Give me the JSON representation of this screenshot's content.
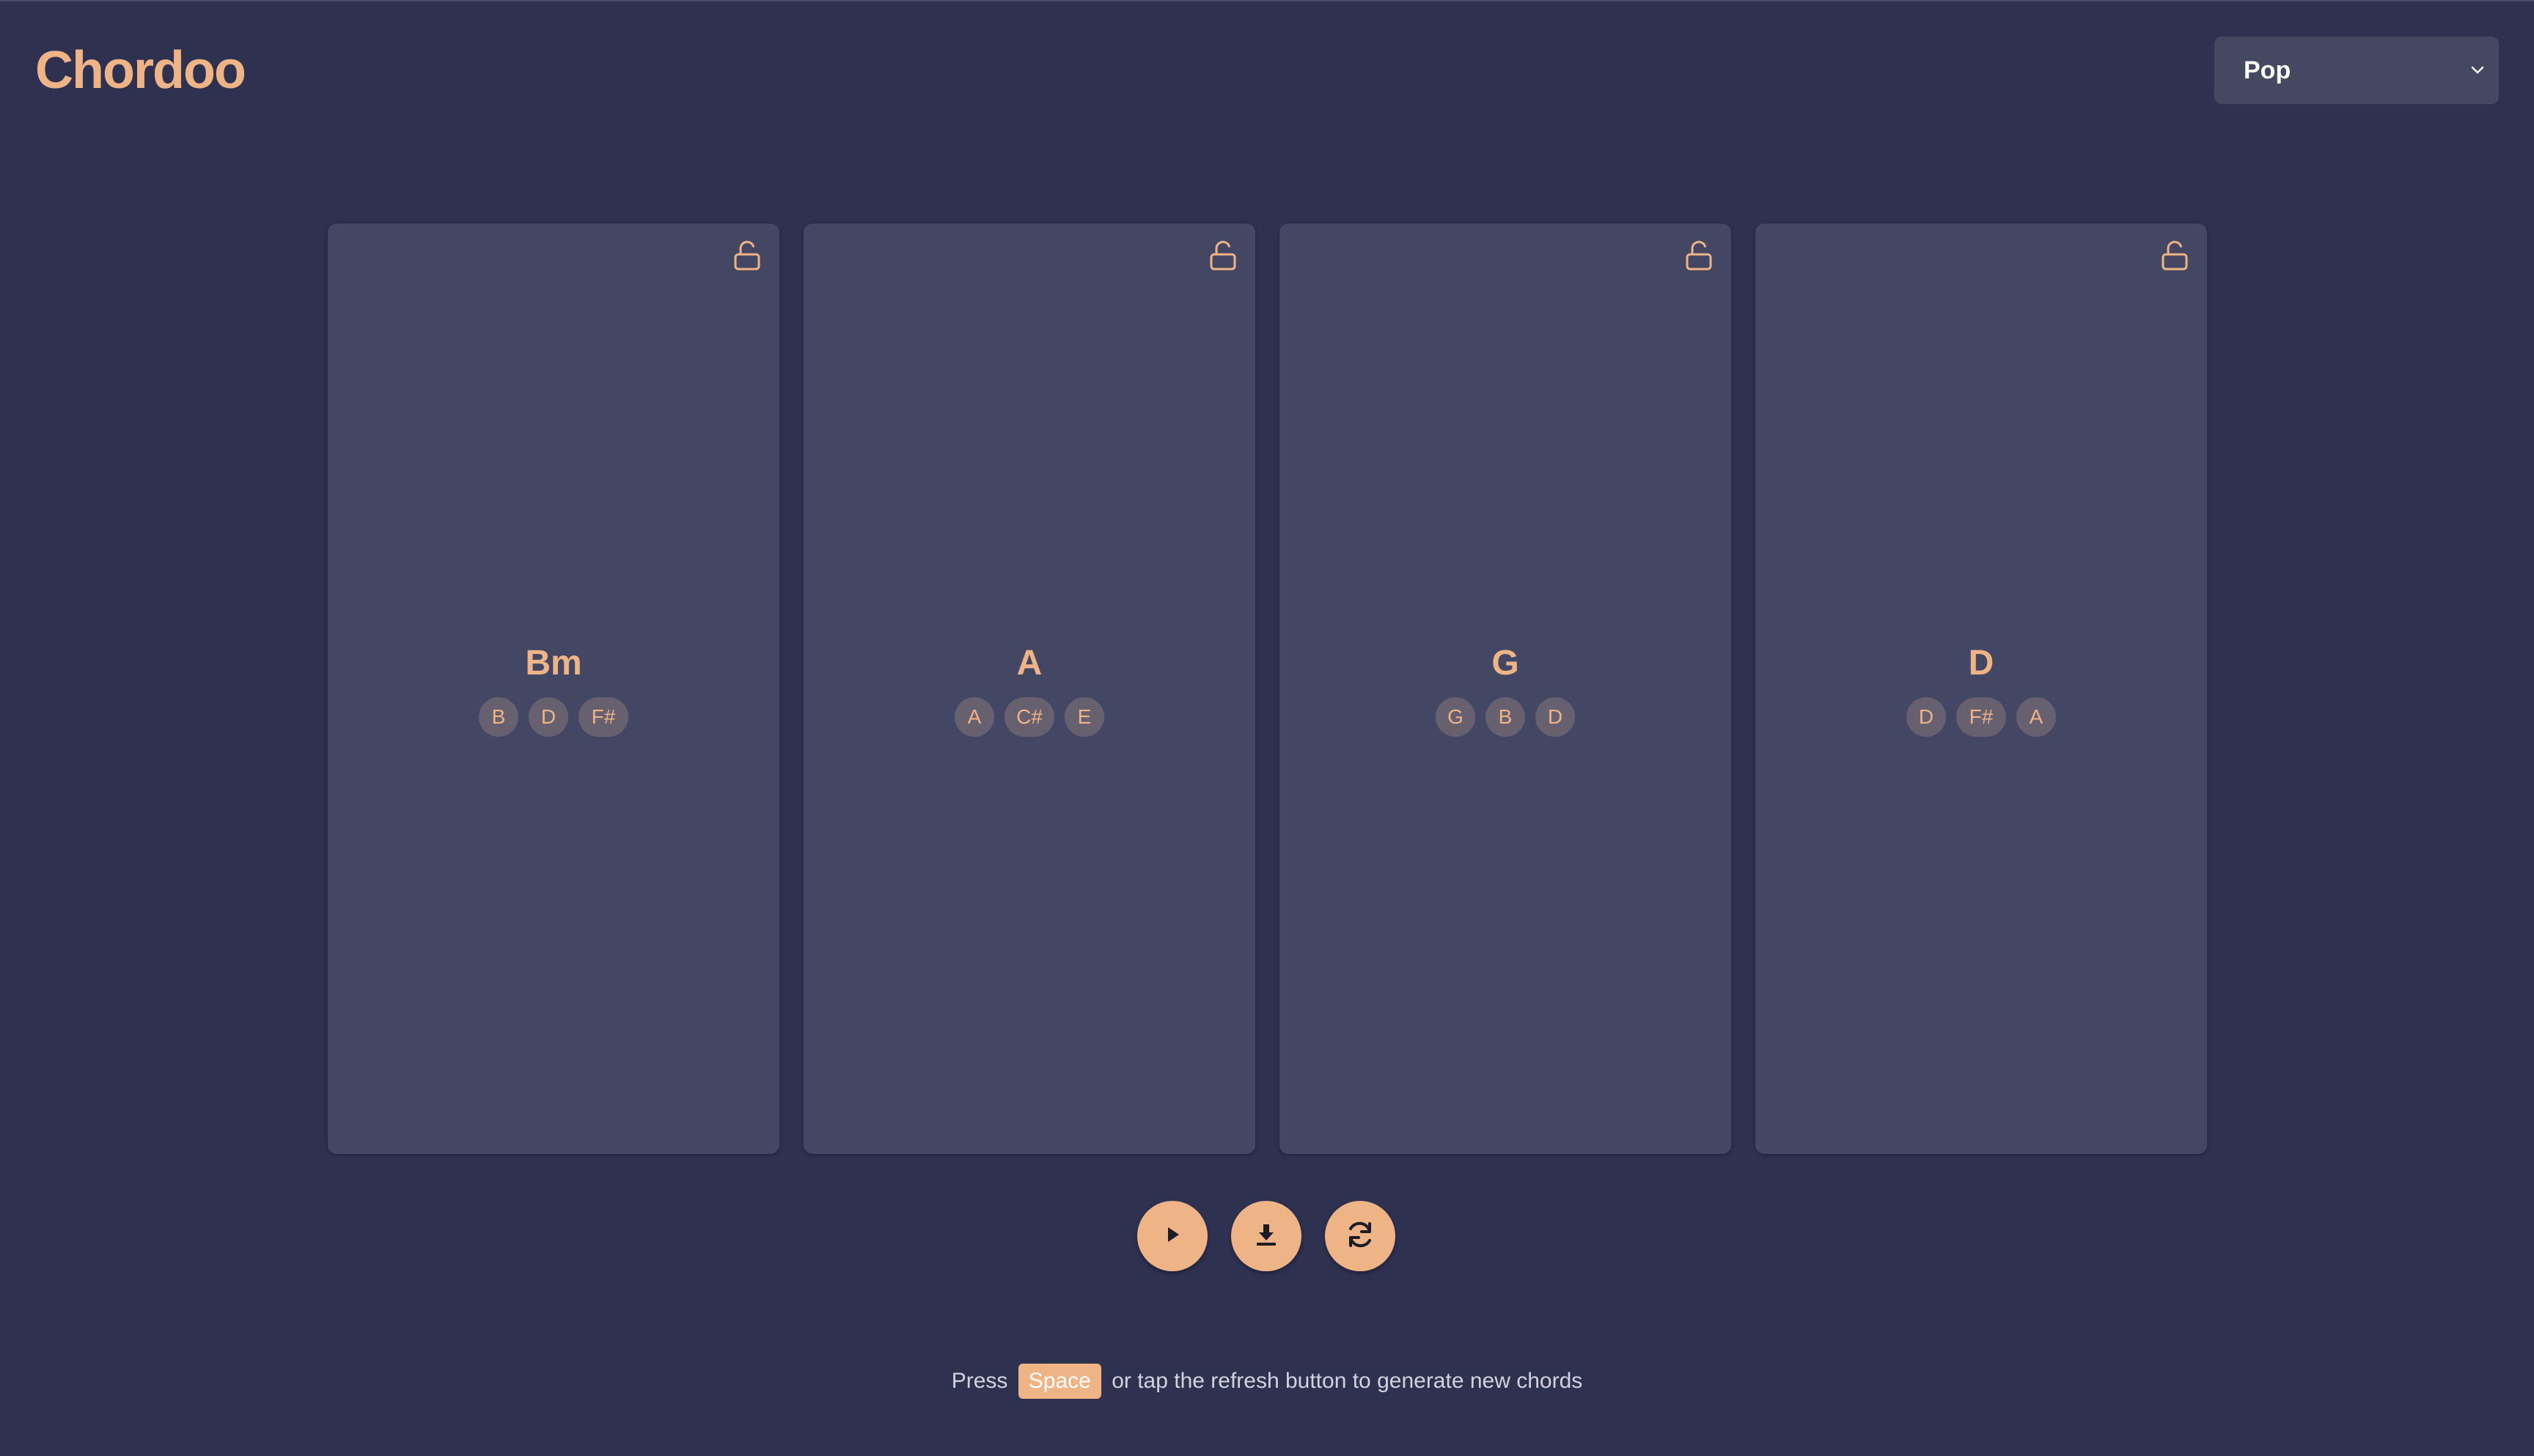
{
  "app": {
    "title": "Chordoo"
  },
  "genre_select": {
    "selected": "Pop"
  },
  "cards": [
    {
      "chord": "Bm",
      "notes": [
        "B",
        "D",
        "F#"
      ],
      "locked": false
    },
    {
      "chord": "A",
      "notes": [
        "A",
        "C#",
        "E"
      ],
      "locked": false
    },
    {
      "chord": "G",
      "notes": [
        "G",
        "B",
        "D"
      ],
      "locked": false
    },
    {
      "chord": "D",
      "notes": [
        "D",
        "F#",
        "A"
      ],
      "locked": false
    }
  ],
  "controls": {
    "play_icon": "play-icon",
    "download_icon": "download-icon",
    "refresh_icon": "refresh-icon"
  },
  "hint": {
    "before": "Press",
    "key": "Space",
    "after": "or tap the refresh button to generate new chords"
  },
  "colors": {
    "background": "#2e3150",
    "card": "#434764",
    "accent": "#eeb486",
    "note_bg": "#66606f",
    "select_bg": "#444861"
  }
}
